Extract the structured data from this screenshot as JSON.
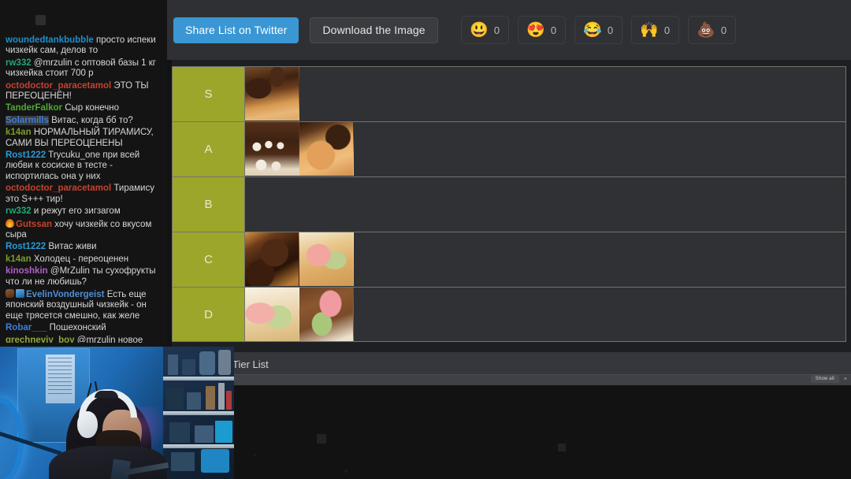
{
  "chat": {
    "messages": [
      {
        "name": "woundedtankbubble",
        "color": "#1f8fc9",
        "text": "просто испеки чизкейк сам, делов то",
        "badges": [],
        "highlighted": false
      },
      {
        "name": "rw332",
        "color": "#21a87a",
        "text": "@mrzulin с оптовой базы 1 кг чизкейка стоит 700 р",
        "badges": [],
        "highlighted": false
      },
      {
        "name": "octodoctor_paracetamol",
        "color": "#c4422f",
        "text": "ЭТО ТЫ ПЕРЕОЦЕНЁН!",
        "badges": [],
        "highlighted": false
      },
      {
        "name": "TanderFalkor",
        "color": "#4fa832",
        "text": "Сыр конечно",
        "badges": [],
        "highlighted": false
      },
      {
        "name": "Solarmills",
        "color": "#3d7fd6",
        "text": "Витас, когда бб то?",
        "badges": [],
        "highlighted": true
      },
      {
        "name": "k14an",
        "color": "#7a9b2e",
        "text": "НОРМАЛЬНЫЙ ТИРАМИСУ, САМИ ВЫ ПЕРЕОЦЕНЕНЫ",
        "badges": [],
        "highlighted": false
      },
      {
        "name": "Rost1222",
        "color": "#2a9ad6",
        "text": "Trycuku_one при всей любви к сосиске в тесте - испортилась она у них",
        "badges": [],
        "highlighted": false
      },
      {
        "name": "octodoctor_paracetamol",
        "color": "#c4422f",
        "text": "Тирамису это S+++ тир!",
        "badges": [],
        "highlighted": false
      },
      {
        "name": "rw332",
        "color": "#21a87a",
        "text": "и режут его зигзагом",
        "badges": [],
        "highlighted": false
      },
      {
        "name": "Gutssan",
        "color": "#c4422f",
        "text": "хочу чизкейк со вкусом сыра",
        "badges": [
          "fire-badge-icon"
        ],
        "highlighted": false
      },
      {
        "name": "Rost1222",
        "color": "#2a9ad6",
        "text": "Витас живи",
        "badges": [],
        "highlighted": false
      },
      {
        "name": "k14an",
        "color": "#7a9b2e",
        "text": "Холодец - переоценен",
        "badges": [],
        "highlighted": false
      },
      {
        "name": "kinoshkin",
        "color": "#b05fc9",
        "text": "@MrZulin ты сухофрукты что ли не любишь?",
        "badges": [],
        "highlighted": false
      },
      {
        "name": "EvelinVondergeist",
        "color": "#4f8fd6",
        "text": "Есть еще японский воздушный чизкейк - он еще трясется смешно, как желе",
        "badges": [
          "bear-badge-icon",
          "subscriber-badge-icon"
        ],
        "highlighted": false
      },
      {
        "name": "Robar___",
        "color": "#3d7fd6",
        "text": "Пошехонский",
        "badges": [],
        "highlighted": false
      },
      {
        "name": "grechneviy_boy",
        "color": "#8fa83a",
        "text": "@mrzulin новое дополнение для бласфемуса видели ?",
        "badges": [],
        "highlighted": false
      }
    ]
  },
  "toolbar": {
    "share_label": "Share List on Twitter",
    "download_label": "Download the Image",
    "accent_color": "#3a97d4",
    "reactions": [
      {
        "emoji": "😃",
        "name": "grinning-face-reaction",
        "count": "0"
      },
      {
        "emoji": "😍",
        "name": "heart-eyes-reaction",
        "count": "0"
      },
      {
        "emoji": "😂",
        "name": "joy-face-reaction",
        "count": "0"
      },
      {
        "emoji": "🙌",
        "name": "raised-hands-reaction",
        "count": "0"
      },
      {
        "emoji": "💩",
        "name": "poop-reaction",
        "count": "0"
      }
    ]
  },
  "tier_list": {
    "label_color": "#9ca62b",
    "rows": [
      {
        "label": "S",
        "items": [
          {
            "name": "chocolate-eclair-thumb",
            "style": "img-choc-eclair"
          }
        ]
      },
      {
        "label": "A",
        "items": [
          {
            "name": "chocolate-cream-cake-thumb",
            "style": "img-choc-cream"
          },
          {
            "name": "cone-pastry-thumb",
            "style": "img-cone"
          }
        ]
      },
      {
        "label": "B",
        "items": []
      },
      {
        "label": "C",
        "items": [
          {
            "name": "chocolate-ball-thumb",
            "style": "img-choc-ball"
          },
          {
            "name": "pink-green-cream-thumb",
            "style": "img-pink-green"
          }
        ]
      },
      {
        "label": "D",
        "items": [
          {
            "name": "pink-green-tart-thumb",
            "style": "img-pink-green2"
          },
          {
            "name": "pink-swirl-cake-thumb",
            "style": "img-pink-swirl"
          }
        ]
      }
    ]
  },
  "browser": {
    "title": "Tier List",
    "downloads": {
      "show_all_label": "Show all",
      "close_label": "×"
    }
  }
}
